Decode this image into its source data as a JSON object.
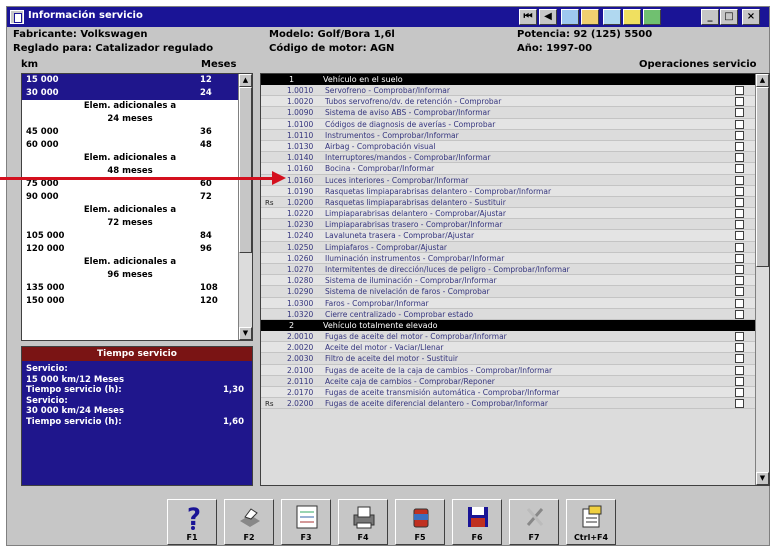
{
  "window": {
    "title": "Información servicio",
    "controls": {
      "minimize": "_",
      "maximize": "□",
      "close": "×"
    }
  },
  "nav": {
    "first": "⏮",
    "prev": "◀"
  },
  "vehicle": {
    "manufacturer": "Fabricante: Volkswagen",
    "model": "Modelo: Golf/Bora 1,6l",
    "power": "Potencia: 92 (125) 5500",
    "setting": "Reglado para: Catalizador regulado",
    "engine_code": "Código de motor: AGN",
    "year": "Año: 1997-00"
  },
  "interval_list": {
    "col_km": "km",
    "col_months": "Meses",
    "rows": [
      {
        "km": "15 000",
        "months": "12",
        "selected": true
      },
      {
        "km": "30 000",
        "months": "24",
        "selected": true
      },
      {
        "extra": "Elem. adicionales a"
      },
      {
        "extra": "24 meses"
      },
      {
        "km": "45 000",
        "months": "36"
      },
      {
        "km": "60 000",
        "months": "48"
      },
      {
        "extra": "Elem. adicionales a"
      },
      {
        "extra": "48 meses"
      },
      {
        "km": "75 000",
        "months": "60"
      },
      {
        "km": "90 000",
        "months": "72"
      },
      {
        "extra": "Elem. adicionales a"
      },
      {
        "extra": "72 meses"
      },
      {
        "km": "105 000",
        "months": "84"
      },
      {
        "km": "120 000",
        "months": "96"
      },
      {
        "extra": "Elem. adicionales a"
      },
      {
        "extra": "96 meses"
      },
      {
        "km": "135 000",
        "months": "108"
      },
      {
        "km": "150 000",
        "months": "120"
      }
    ]
  },
  "service_time": {
    "title": "Tiempo servicio",
    "lines": [
      {
        "text": "Servicio:"
      },
      {
        "text": "15 000 km/12 Meses"
      },
      {
        "text": "Tiempo servicio (h):",
        "value": "1,30"
      },
      {
        "text": "Servicio:"
      },
      {
        "text": "30 000 km/24 Meses"
      },
      {
        "text": "Tiempo servicio (h):",
        "value": "1,60"
      }
    ]
  },
  "operations": {
    "header": "Operaciones servicio",
    "sections": [
      {
        "num": "1",
        "title": "Vehículo en el suelo",
        "items": [
          {
            "code": "1.0010",
            "desc": "Servofreno - Comprobar/Informar"
          },
          {
            "code": "1.0020",
            "desc": "Tubos servofreno/dv. de retención - Comprobar"
          },
          {
            "code": "1.0090",
            "desc": "Sistema de aviso ABS - Comprobar/Informar"
          },
          {
            "code": "1.0100",
            "desc": "Códigos de diagnosis de averías - Comprobar"
          },
          {
            "code": "1.0110",
            "desc": "Instrumentos - Comprobar/Informar"
          },
          {
            "code": "1.0130",
            "desc": "Airbag - Comprobación visual"
          },
          {
            "code": "1.0140",
            "desc": "Interruptores/mandos - Comprobar/Informar"
          },
          {
            "code": "1.0160",
            "desc": "Bocina - Comprobar/Informar"
          },
          {
            "code": "1.0160",
            "desc": "Luces interiores - Comprobar/Informar"
          },
          {
            "code": "1.0190",
            "desc": "Rasquetas limpiaparabrisas delantero - Comprobar/Informar"
          },
          {
            "code": "1.0200",
            "desc": "Rasquetas limpiaparabrisas delantero - Sustituir",
            "note": "Rs"
          },
          {
            "code": "1.0220",
            "desc": "Limpiaparabrisas delantero - Comprobar/Ajustar"
          },
          {
            "code": "1.0230",
            "desc": "Limpiaparabrisas trasero - Comprobar/Informar"
          },
          {
            "code": "1.0240",
            "desc": "Lavaluneta trasera - Comprobar/Ajustar"
          },
          {
            "code": "1.0250",
            "desc": "Limpiafaros - Comprobar/Ajustar"
          },
          {
            "code": "1.0260",
            "desc": "Iluminación instrumentos - Comprobar/Informar"
          },
          {
            "code": "1.0270",
            "desc": "Intermitentes de dirección/luces de peligro - Comprobar/Informar"
          },
          {
            "code": "1.0280",
            "desc": "Sistema de iluminación - Comprobar/Informar"
          },
          {
            "code": "1.0290",
            "desc": "Sistema de nivelación de faros - Comprobar"
          },
          {
            "code": "1.0300",
            "desc": "Faros - Comprobar/Informar"
          },
          {
            "code": "1.0320",
            "desc": "Cierre centralizado - Comprobar estado"
          }
        ]
      },
      {
        "num": "2",
        "title": "Vehículo totalmente elevado",
        "items": [
          {
            "code": "2.0010",
            "desc": "Fugas de aceite del motor - Comprobar/Informar"
          },
          {
            "code": "2.0020",
            "desc": "Aceite del motor - Vaciar/Llenar"
          },
          {
            "code": "2.0030",
            "desc": "Filtro de aceite del motor - Sustituir"
          },
          {
            "code": "2.0100",
            "desc": "Fugas de aceite de la caja de cambios - Comprobar/Informar"
          },
          {
            "code": "2.0110",
            "desc": "Aceite caja de cambios - Comprobar/Reponer"
          },
          {
            "code": "2.0170",
            "desc": "Fugas de aceite transmisión automática - Comprobar/Informar"
          },
          {
            "code": "2.0200",
            "desc": "Fugas de aceite diferencial delantero - Comprobar/Informar",
            "note": "Rs"
          }
        ]
      }
    ]
  },
  "toolbar": {
    "buttons": [
      {
        "label": "F1",
        "icon": "help-icon"
      },
      {
        "label": "F2",
        "icon": "print-icon"
      },
      {
        "label": "F3",
        "icon": "checklist-icon"
      },
      {
        "label": "F4",
        "icon": "printer-list-icon"
      },
      {
        "label": "F5",
        "icon": "oil-can-icon"
      },
      {
        "label": "F6",
        "icon": "save-icon"
      },
      {
        "label": "F7",
        "icon": "tools-icon"
      },
      {
        "label": "Ctrl+F4",
        "icon": "notes-icon"
      }
    ]
  },
  "colors": {
    "title_bar": "#1a1496",
    "selection": "#1f168c",
    "service_time_header": "#7a1414",
    "arrow": "#d4101e"
  }
}
